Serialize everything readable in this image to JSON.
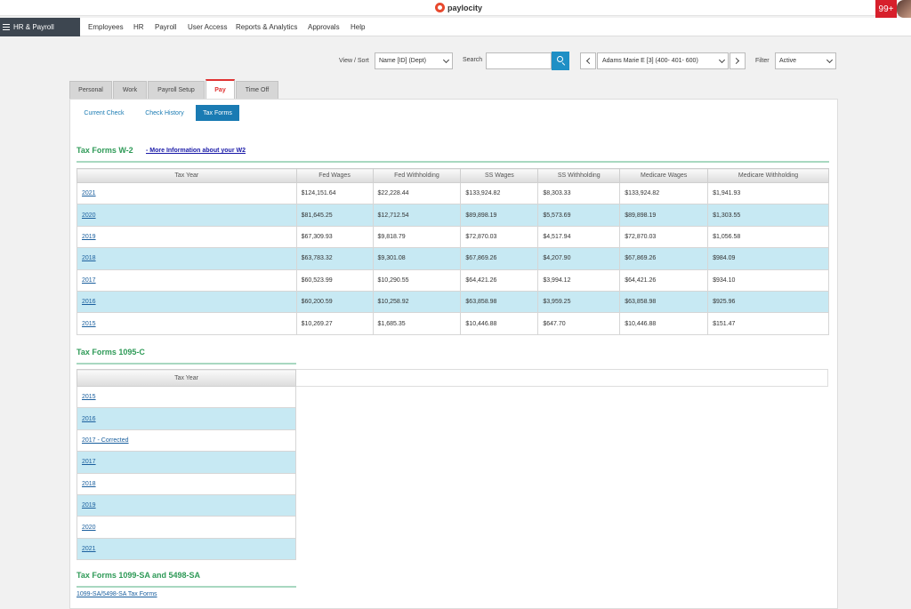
{
  "header": {
    "brand": "paylocity",
    "notification_count": "99+"
  },
  "nav": {
    "app_label": "HR & Payroll",
    "items": [
      "Employees",
      "HR",
      "Payroll",
      "User Access",
      "Reports & Analytics",
      "Approvals",
      "Help"
    ]
  },
  "toolbar": {
    "view_sort_label": "View / Sort",
    "view_sort_value": "Name [ID] (Dept)",
    "search_label": "Search",
    "search_value": "",
    "employee_value": "Adams Marie E [3] (400- 401- 600)",
    "filter_label": "Filter",
    "filter_value": "Active"
  },
  "tabs": [
    "Personal",
    "Work",
    "Payroll Setup",
    "Pay",
    "Time Off"
  ],
  "active_tab": "Pay",
  "subtabs": [
    "Current Check",
    "Check History",
    "Tax Forms"
  ],
  "active_subtab": "Tax Forms",
  "w2": {
    "title": "Tax Forms W-2",
    "more_info_link": "- More Information about your W2",
    "columns": [
      "Tax Year",
      "Fed Wages",
      "Fed Withholding",
      "SS Wages",
      "SS Withholding",
      "Medicare Wages",
      "Medicare Withholding"
    ],
    "rows": [
      [
        "2021",
        "$124,151.64",
        "$22,228.44",
        "$133,924.82",
        "$8,303.33",
        "$133,924.82",
        "$1,941.93"
      ],
      [
        "2020",
        "$81,645.25",
        "$12,712.54",
        "$89,898.19",
        "$5,573.69",
        "$89,898.19",
        "$1,303.55"
      ],
      [
        "2019",
        "$67,309.93",
        "$9,818.79",
        "$72,870.03",
        "$4,517.94",
        "$72,870.03",
        "$1,056.58"
      ],
      [
        "2018",
        "$63,783.32",
        "$9,301.08",
        "$67,869.26",
        "$4,207.90",
        "$67,869.26",
        "$984.09"
      ],
      [
        "2017",
        "$60,523.99",
        "$10,290.55",
        "$64,421.26",
        "$3,994.12",
        "$64,421.26",
        "$934.10"
      ],
      [
        "2016",
        "$60,200.59",
        "$10,258.92",
        "$63,858.98",
        "$3,959.25",
        "$63,858.98",
        "$925.96"
      ],
      [
        "2015",
        "$10,269.27",
        "$1,685.35",
        "$10,446.88",
        "$647.70",
        "$10,446.88",
        "$151.47"
      ]
    ]
  },
  "f1095c": {
    "title": "Tax Forms 1095-C",
    "column": "Tax Year",
    "rows": [
      "2015",
      "2016",
      "2017 - Corrected",
      "2017",
      "2018",
      "2019",
      "2020",
      "2021"
    ]
  },
  "f1099": {
    "title": "Tax Forms 1099-SA and 5498-SA",
    "link": "1099-SA/5498-SA Tax Forms"
  }
}
